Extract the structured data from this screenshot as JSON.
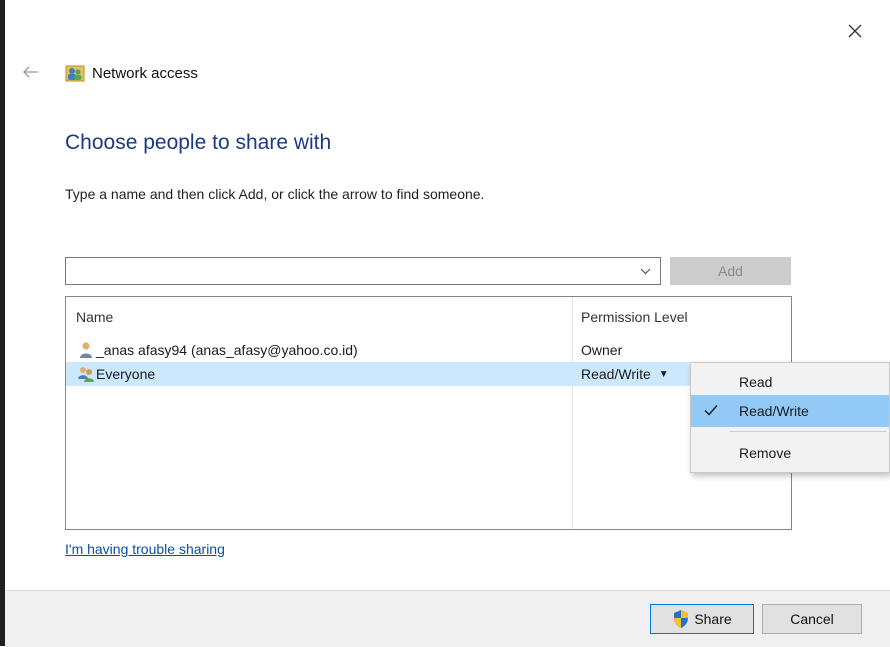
{
  "window": {
    "title": "Network access",
    "close_glyph": "✕",
    "back_glyph": "←"
  },
  "page": {
    "heading": "Choose people to share with",
    "instruction": "Type a name and then click Add, or click the arrow to find someone."
  },
  "name_input": {
    "value": "",
    "placeholder": ""
  },
  "add_button": {
    "label": "Add",
    "enabled": false
  },
  "people_table": {
    "columns": [
      "Name",
      "Permission Level"
    ],
    "rows": [
      {
        "name": "_anas afasy94 (anas_afasy@yahoo.co.id)",
        "permission": "Owner",
        "icon": "user-icon",
        "selected": false
      },
      {
        "name": "Everyone",
        "permission": "Read/Write",
        "icon": "group-icon",
        "selected": true
      }
    ]
  },
  "permission_menu": {
    "items": [
      {
        "label": "Read",
        "checked": false
      },
      {
        "label": "Read/Write",
        "checked": true
      },
      {
        "label": "Remove",
        "checked": false
      }
    ]
  },
  "links": {
    "trouble": "I'm having trouble sharing"
  },
  "footer": {
    "share_label": "Share",
    "cancel_label": "Cancel"
  },
  "colors": {
    "heading": "#1b3a80",
    "link": "#0b4ea2",
    "selected_row": "#cce8ff",
    "menu_highlight": "#91c9f7",
    "footer_bg": "#f0f0f0"
  }
}
